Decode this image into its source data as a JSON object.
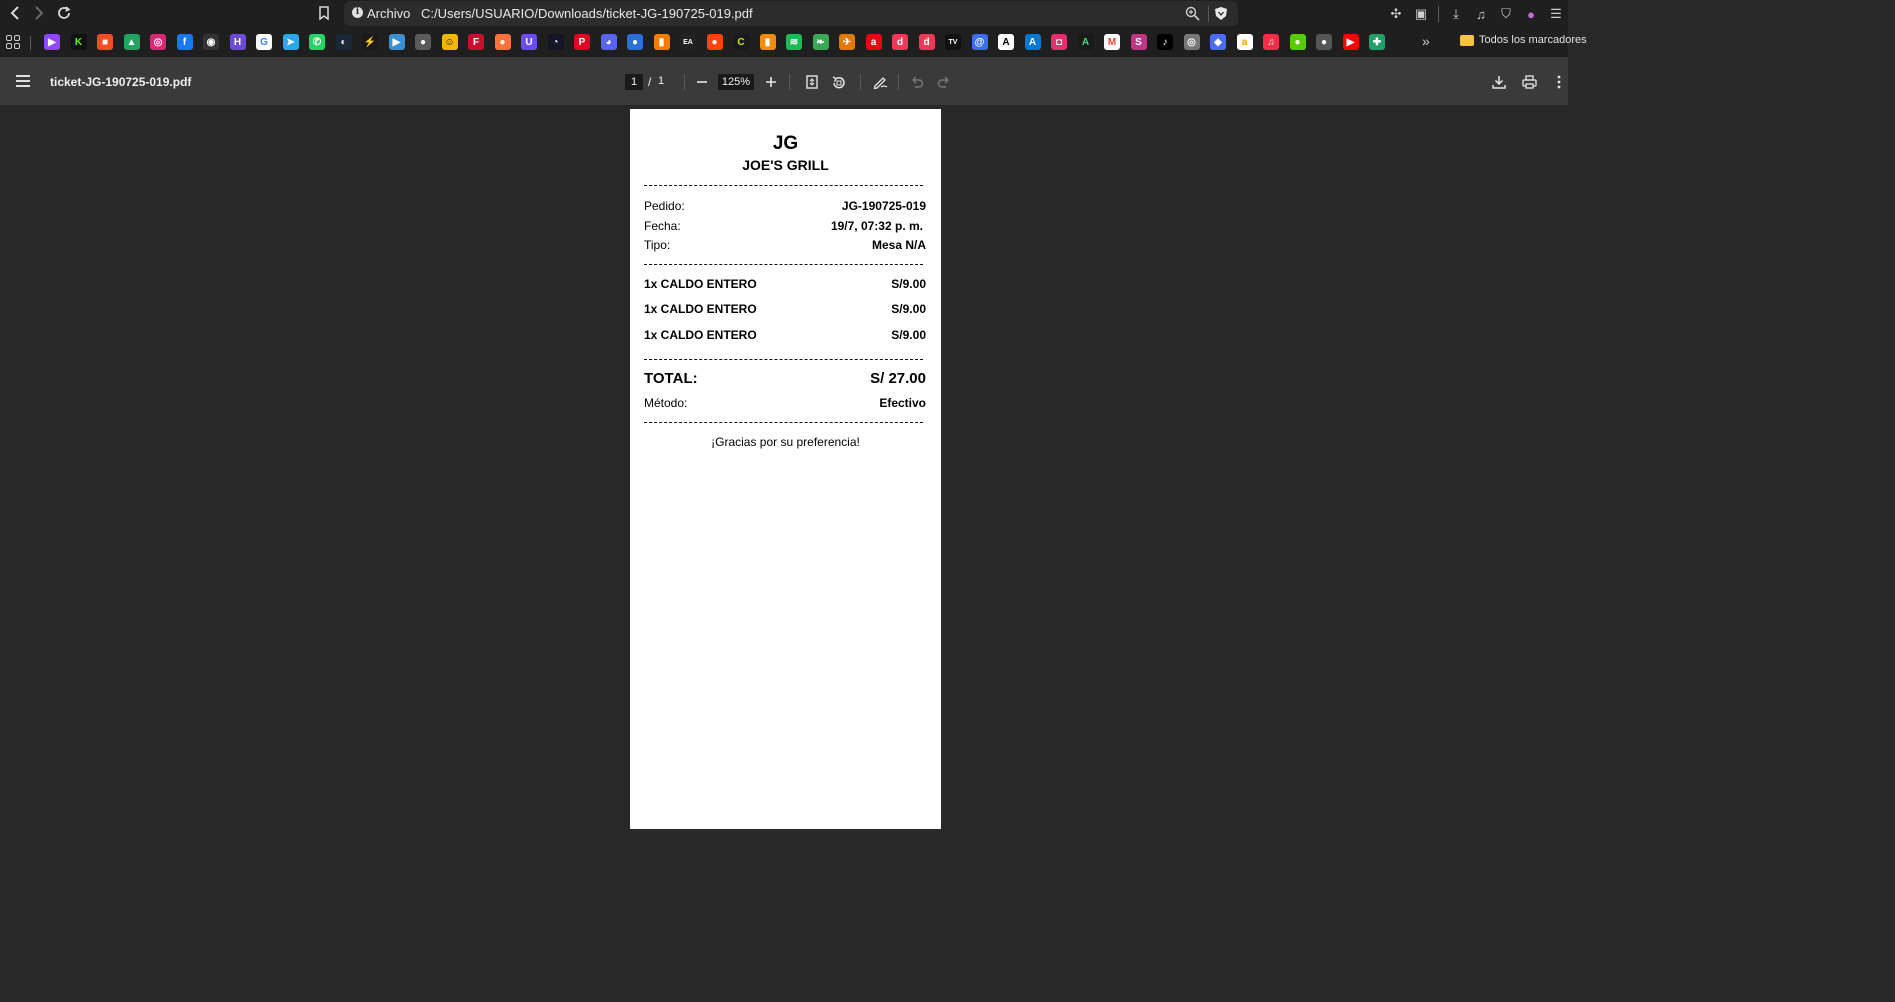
{
  "browser": {
    "url_chip": "Archivo",
    "url": "C:/Users/USUARIO/Downloads/ticket-JG-190725-019.pdf",
    "bookmarks_folder": "Todos los marcadores",
    "bookmark_icons": [
      {
        "name": "twitch-icon",
        "color": "#9146ff",
        "glyph": "▶"
      },
      {
        "name": "kick-icon",
        "color": "#111111",
        "glyph": "K",
        "fg": "#53fc18"
      },
      {
        "name": "microsoft-icon",
        "color": "#f25022",
        "glyph": "■"
      },
      {
        "name": "google-drive-icon",
        "color": "#1fa463",
        "glyph": "▲"
      },
      {
        "name": "instagram-icon",
        "color": "#d62976",
        "glyph": "◎"
      },
      {
        "name": "facebook-icon",
        "color": "#1877f2",
        "glyph": "f"
      },
      {
        "name": "github-icon",
        "color": "#333333",
        "glyph": "◉"
      },
      {
        "name": "hianime-icon",
        "color": "#6c4cd6",
        "glyph": "H"
      },
      {
        "name": "google-icon",
        "color": "#ffffff",
        "glyph": "G",
        "fg": "#4285f4"
      },
      {
        "name": "telegram-icon",
        "color": "#29a9eb",
        "glyph": "➤"
      },
      {
        "name": "whatsapp-icon",
        "color": "#25d366",
        "glyph": "✆"
      },
      {
        "name": "steam-icon",
        "color": "#1b2838",
        "glyph": "◐"
      },
      {
        "name": "pulse-icon",
        "color": "#1a1a1a",
        "glyph": "⚡",
        "fg": "#3ddc84"
      },
      {
        "name": "play-icon",
        "color": "#3b8ed0",
        "glyph": "▶"
      },
      {
        "name": "globe-icon",
        "color": "#5a5a5a",
        "glyph": "●"
      },
      {
        "name": "smile-icon",
        "color": "#f2b705",
        "glyph": "☺",
        "fg": "#000"
      },
      {
        "name": "flag-icon",
        "color": "#c8102e",
        "glyph": "F"
      },
      {
        "name": "firefox-icon",
        "color": "#ff7139",
        "glyph": "●"
      },
      {
        "name": "proton-icon",
        "color": "#6d4aff",
        "glyph": "U"
      },
      {
        "name": "speedtest-icon",
        "color": "#141526",
        "glyph": "◔"
      },
      {
        "name": "pinterest-icon",
        "color": "#e60023",
        "glyph": "P"
      },
      {
        "name": "discord-icon",
        "color": "#5865f2",
        "glyph": "◕"
      },
      {
        "name": "earth-icon",
        "color": "#2a6fdb",
        "glyph": "●"
      },
      {
        "name": "stats-icon",
        "color": "#f57c00",
        "glyph": "▮"
      },
      {
        "name": "ea-icon",
        "color": "#222222",
        "glyph": "EA"
      },
      {
        "name": "reddit-icon",
        "color": "#ff4500",
        "glyph": "●"
      },
      {
        "name": "loader-icon",
        "color": "#1a1a1a",
        "glyph": "C",
        "fg": "#c6e80f"
      },
      {
        "name": "analytics-icon",
        "color": "#f08c00",
        "glyph": "▮"
      },
      {
        "name": "spotify-icon",
        "color": "#1db954",
        "glyph": "≋"
      },
      {
        "name": "feather-icon",
        "color": "#3aa757",
        "glyph": "❧"
      },
      {
        "name": "bird-icon",
        "color": "#e07b00",
        "glyph": "✈"
      },
      {
        "name": "a-icon",
        "color": "#e50914",
        "glyph": "a"
      },
      {
        "name": "d-icon",
        "color": "#ee3a59",
        "glyph": "d"
      },
      {
        "name": "d2-icon",
        "color": "#ee3a59",
        "glyph": "d"
      },
      {
        "name": "tradingview-icon",
        "color": "#111111",
        "glyph": "TV"
      },
      {
        "name": "at-icon",
        "color": "#3c6ff0",
        "glyph": "@"
      },
      {
        "name": "canva-a-icon",
        "color": "#ffffff",
        "glyph": "A",
        "fg": "#000"
      },
      {
        "name": "azure-icon",
        "color": "#0078d4",
        "glyph": "A"
      },
      {
        "name": "instagram-d-icon",
        "color": "#e1306c",
        "glyph": "◘"
      },
      {
        "name": "anime-a-icon",
        "color": "#1a1a1a",
        "glyph": "A",
        "fg": "#3ddc84"
      },
      {
        "name": "gmail-icon",
        "color": "#ffffff",
        "glyph": "M",
        "fg": "#ea4335"
      },
      {
        "name": "s-icon",
        "color": "#c13584",
        "glyph": "S"
      },
      {
        "name": "tiktok-icon",
        "color": "#010101",
        "glyph": "♪"
      },
      {
        "name": "target-icon",
        "color": "#777777",
        "glyph": "◎"
      },
      {
        "name": "deepseek-icon",
        "color": "#4d6bfe",
        "glyph": "◆"
      },
      {
        "name": "amazon-icon",
        "color": "#ffffff",
        "glyph": "a",
        "fg": "#ff9900"
      },
      {
        "name": "music-icon",
        "color": "#fa2d48",
        "glyph": "♫"
      },
      {
        "name": "duolingo-icon",
        "color": "#58cc02",
        "glyph": "●"
      },
      {
        "name": "apple-icon",
        "color": "#555555",
        "glyph": "●"
      },
      {
        "name": "youtube-icon",
        "color": "#ff0000",
        "glyph": "▶"
      },
      {
        "name": "puzzle-green-icon",
        "color": "#22a06b",
        "glyph": "✚"
      }
    ]
  },
  "pdf_toolbar": {
    "title": "ticket-JG-190725-019.pdf",
    "page_current": "1",
    "page_separator": "/",
    "page_total": "1",
    "zoom": "125%"
  },
  "receipt": {
    "brand": "JG",
    "name": "JOE'S GRILL",
    "pedido_label": "Pedido:",
    "pedido_value": "JG-190725-019",
    "fecha_label": "Fecha:",
    "fecha_value": "19/7, 07:32 p. m.",
    "tipo_label": "Tipo:",
    "tipo_value": "Mesa N/A",
    "items": [
      {
        "desc": "1x CALDO ENTERO",
        "price": "S/9.00"
      },
      {
        "desc": "1x CALDO ENTERO",
        "price": "S/9.00"
      },
      {
        "desc": "1x CALDO ENTERO",
        "price": "S/9.00"
      }
    ],
    "total_label": "TOTAL:",
    "total_value": "S/ 27.00",
    "metodo_label": "Método:",
    "metodo_value": "Efectivo",
    "thanks": "¡Gracias por su preferencia!"
  }
}
